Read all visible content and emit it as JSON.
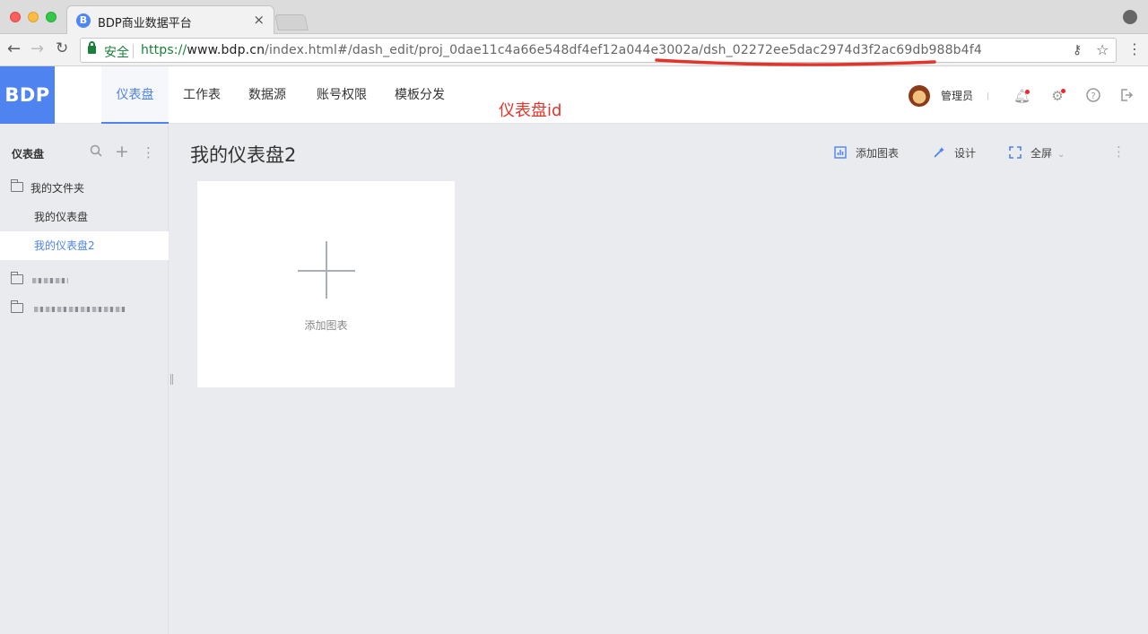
{
  "browser": {
    "tab_title": "BDP商业数据平台",
    "tab_favicon": "B",
    "tab_close": "×",
    "security_label": "安全",
    "url": {
      "scheme": "https://",
      "host": "www.bdp.cn",
      "path": "/index.html#/dash_edit/proj_0dae11c4a66e548df4ef12a044e3002a/dsh_02272ee5dac2974d3f2ac69db988b4f4"
    },
    "icons": [
      "back-icon",
      "forward-icon",
      "reload-icon",
      "key-icon",
      "star-icon",
      "more-vert-icon",
      "profile-icon"
    ]
  },
  "app": {
    "logo": "BDP",
    "nav": [
      "仪表盘",
      "工作表",
      "数据源",
      "账号权限",
      "模板分发"
    ],
    "active_nav": "仪表盘",
    "accent": "#4e83f0",
    "user_name": "管理员",
    "header_icons": [
      "bell-icon",
      "gear-icon",
      "help-icon",
      "logout-icon"
    ]
  },
  "annotation": {
    "text": "仪表盘id",
    "color": "#e3342c"
  },
  "sidebar": {
    "title": "仪表盘",
    "folder": "我的文件夹",
    "items": [
      "我的仪表盘",
      "我的仪表盘2"
    ],
    "selected": "我的仪表盘2"
  },
  "main": {
    "title": "我的仪表盘2",
    "actions": {
      "add_chart": "添加图表",
      "design": "设计",
      "fullscreen": "全屏"
    },
    "card_label": "添加图表"
  }
}
